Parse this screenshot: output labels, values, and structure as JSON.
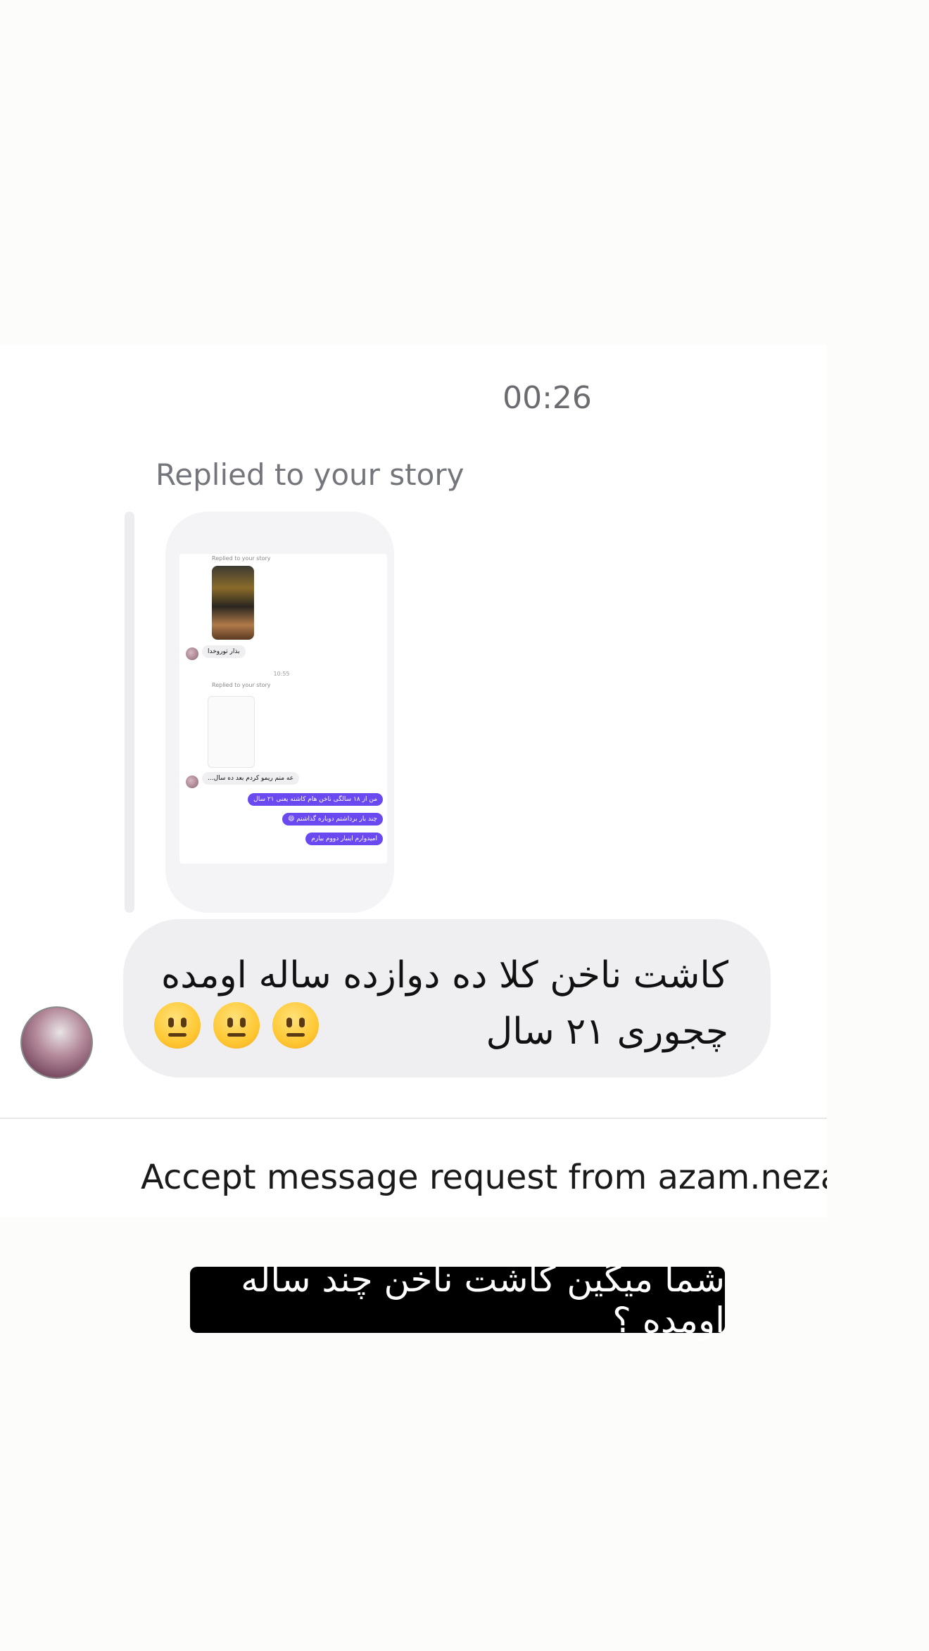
{
  "thread": {
    "timestamp": "00:26",
    "reply_label": "Replied to your story",
    "story_screenshot": {
      "reply_label_1": "Replied to your story",
      "message_1": "بذار تورو‌خدا",
      "time": "10:55",
      "reply_label_2": "Replied to your story",
      "message_2": "عه منم ریمو کردم بعد ده سال...",
      "outgoing": [
        "من از ۱۸ سالگی ناخن هام کاشته یعنی ۲۱ سال",
        "چند بار برداشتم دوباره گذاشتم 😄",
        "امیدوارم اینبار دووم بیارم"
      ]
    },
    "message": {
      "line1": "کاشت ناخن کلا ده دوازده ساله اومده",
      "line2": "چجوری ۲۱ سال",
      "emojis": [
        "neutral-face",
        "neutral-face",
        "neutral-face"
      ]
    }
  },
  "request": {
    "text": "Accept message request from azam.neza"
  },
  "overlay": {
    "caption": "شما میگین کاشت ناخن چند ساله اومده ؟"
  },
  "colors": {
    "outgoing_bubble": "#6a49f0",
    "incoming_bubble": "#efeff2",
    "caption_bg": "#000000"
  }
}
